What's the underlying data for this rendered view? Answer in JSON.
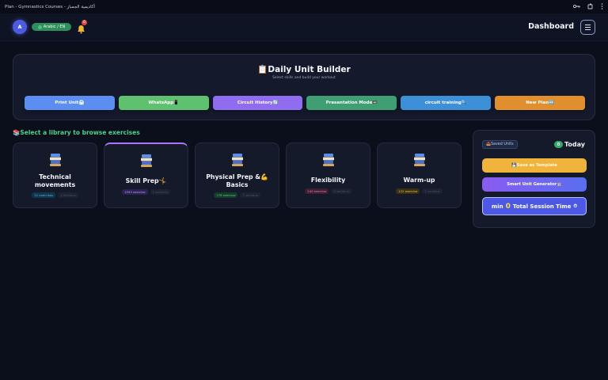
{
  "window": {
    "title": "Plan - Gymnastics Courses - أكاديمية الجمباز",
    "icons": [
      "key-icon",
      "extension-icon",
      "more-vert-icon"
    ]
  },
  "header": {
    "avatar_letter": "A",
    "language_label": "Arabic / EN",
    "notification_count": "0",
    "page_title": "Dashboard"
  },
  "builder": {
    "title": "📋Daily Unit Builder",
    "subtitle": "Select skills and build your workout",
    "actions": [
      {
        "label": "Print Unit🖨",
        "color": "#5b8ef0"
      },
      {
        "label": "WhatsApp📱",
        "color": "#5fc070"
      },
      {
        "label": "Circuit History🔄",
        "color": "#8f6cf0"
      },
      {
        "label": "Presentation Mode📼",
        "color": "#3f9e72"
      },
      {
        "label": "circuit training🔍",
        "color": "#3d8fd8"
      },
      {
        "label": "New Plan🆕",
        "color": "#e08e2e"
      }
    ]
  },
  "library": {
    "heading": "📚Select a library to browse exercises",
    "cards": [
      {
        "title_line1": "Technical",
        "title_line2": "movements",
        "count": "31 exercises",
        "sections": "1 Sections",
        "tag_bg": "#123549",
        "tag_color": "#4fb6e6"
      },
      {
        "title_line1": "Skill Prep🤸",
        "title_line2": "",
        "count": "1993 exercise",
        "sections": "1 sections",
        "tag_bg": "#2c2350",
        "tag_color": "#b79aff"
      },
      {
        "title_line1": "Physical Prep &💪",
        "title_line2": "Basics",
        "count": "276 exercise",
        "sections": "7 sections",
        "tag_bg": "#163a2a",
        "tag_color": "#4fd08a"
      },
      {
        "title_line1": "Flexibility",
        "title_line2": "",
        "count": "240 exercise",
        "sections": "4 sections",
        "tag_bg": "#3c1f33",
        "tag_color": "#f07ab2"
      },
      {
        "title_line1": "Warm-up",
        "title_line2": "",
        "count": "122 exercise",
        "sections": "7 sections",
        "tag_bg": "#3a3018",
        "tag_color": "#f0c040"
      }
    ]
  },
  "sidebar": {
    "saved_units": "📥Saved Units",
    "today_count": "0",
    "today_label": "Today",
    "save_template": "💾Save as Template",
    "smart_generator": "Smart Unit Generator🤖",
    "session_prefix": "min",
    "session_minutes": "0",
    "session_label": "Total Session Time",
    "session_icon": "⏱"
  }
}
